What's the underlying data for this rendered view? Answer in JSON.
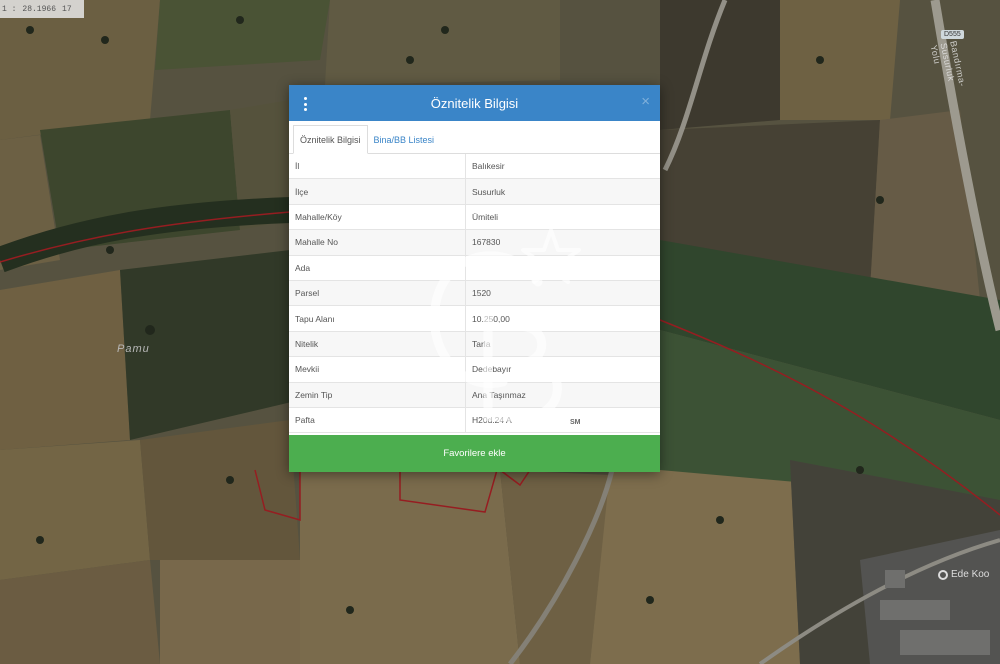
{
  "map": {
    "coords": {
      "prefix": "1 :",
      "value": "28.1966",
      "extra": "17"
    },
    "road_label": "Bandırma-Susurluk Yolu",
    "road_shield": "D555",
    "area_label": "Pamu",
    "place_label": "Ede Koo"
  },
  "modal": {
    "title": "Öznitelik Bilgisi",
    "close_glyph": "×",
    "tabs": [
      {
        "label": "Öznitelik Bilgisi",
        "active": true
      },
      {
        "label": "Bina/BB Listesi",
        "active": false
      }
    ],
    "rows": [
      {
        "key": "İl",
        "value": "Balıkesir"
      },
      {
        "key": "İlçe",
        "value": "Susurluk"
      },
      {
        "key": "Mahalle/Köy",
        "value": "Ümiteli"
      },
      {
        "key": "Mahalle No",
        "value": "167830"
      },
      {
        "key": "Ada",
        "value": ""
      },
      {
        "key": "Parsel",
        "value": "1520"
      },
      {
        "key": "Tapu Alanı",
        "value": "10.250,00"
      },
      {
        "key": "Nitelik",
        "value": "Tarla"
      },
      {
        "key": "Mevkii",
        "value": "Dedebayır"
      },
      {
        "key": "Zemin Tip",
        "value": "Ana Taşınmaz"
      },
      {
        "key": "Pafta",
        "value": "H20d.24 A"
      }
    ],
    "favorite_label": "Favorilere ekle"
  },
  "watermark": {
    "badge": "SM"
  },
  "colors": {
    "header": "#3a85c8",
    "button": "#4cae4f",
    "parcel_line": "#c0262b"
  }
}
